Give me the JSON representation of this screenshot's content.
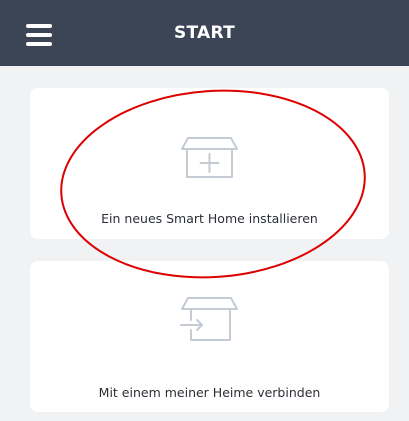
{
  "header": {
    "title": "START",
    "menu_icon": "hamburger-menu-icon"
  },
  "cards": [
    {
      "label": "Ein neues Smart Home installieren",
      "icon": "house-plus-icon"
    },
    {
      "label": "Mit einem meiner Heime verbinden",
      "icon": "house-enter-arrow-icon"
    }
  ],
  "colors": {
    "header_bg": "#3b4556",
    "page_bg": "#f1f2f4",
    "card_bg": "#ffffff",
    "icon_stroke": "#c5cbd4",
    "annotation": "#dd0000"
  }
}
